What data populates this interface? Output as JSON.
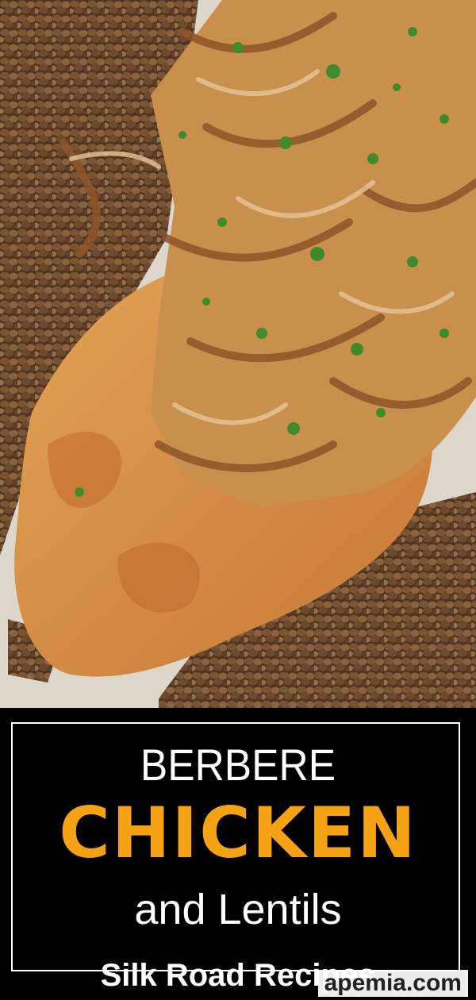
{
  "photo": {
    "subject": "plate-photo",
    "colors": {
      "plate": "#d9d3c9",
      "lentil": "#6b4a2e",
      "chicken": "#d79a4f",
      "onion": "#b47a44",
      "parsley": "#3f8a2a"
    }
  },
  "title": {
    "line1": "BERBERE",
    "line2": "CHICKEN",
    "line3": "and Lentils"
  },
  "brand": {
    "name_part1": "Silk Road Rec",
    "name_part2": "i",
    "name_part3": "pes"
  },
  "watermark": {
    "text": "apemia.com"
  },
  "colors": {
    "accent": "#f5a314",
    "background": "#000000",
    "text": "#ffffff"
  }
}
